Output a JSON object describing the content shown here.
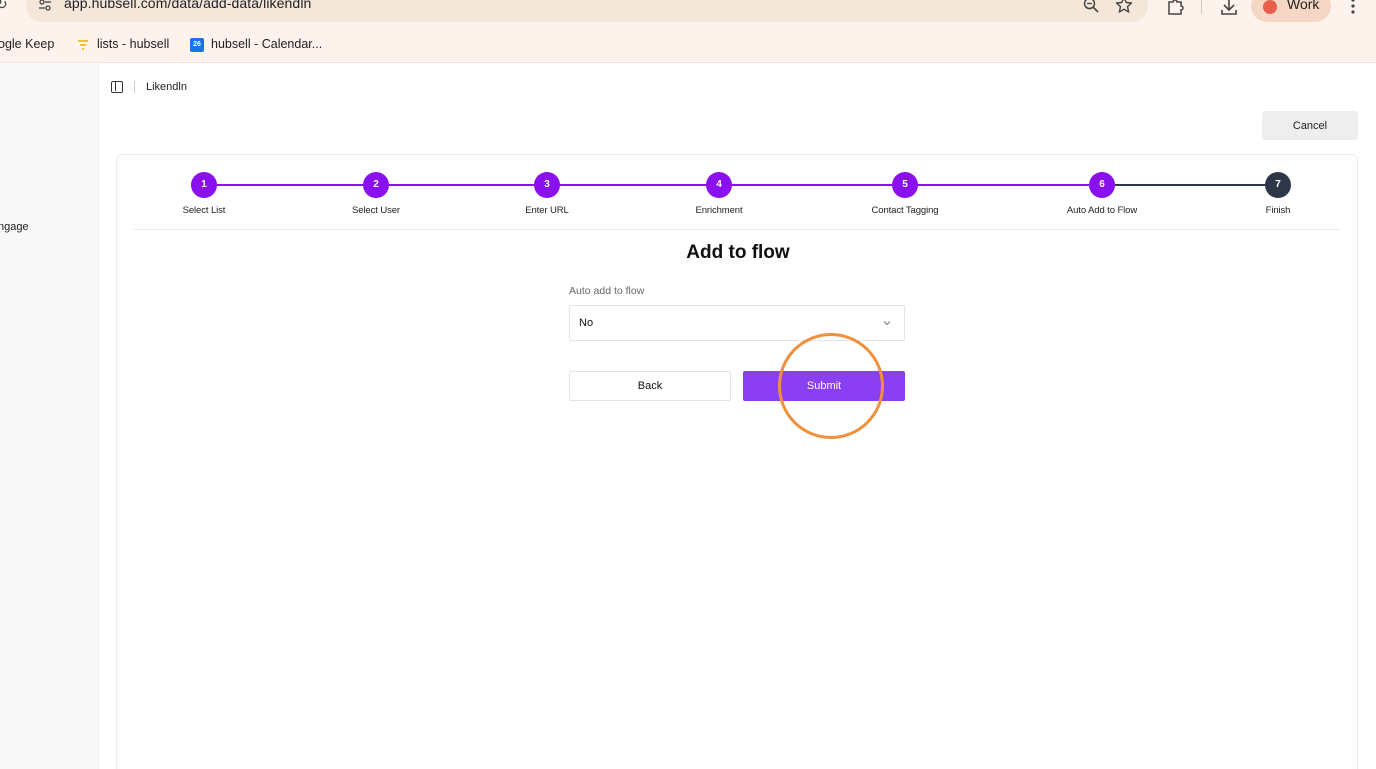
{
  "browser": {
    "url": "app.hubsell.com/data/add-data/likendln",
    "profile_label": "Work",
    "bookmarks": [
      {
        "label": "ogle Keep"
      },
      {
        "label": "lists - hubsell"
      },
      {
        "label": "hubsell - Calendar..."
      }
    ],
    "calendar_icon_text": "26"
  },
  "sidebar": {
    "partial_item": "ngage"
  },
  "header": {
    "breadcrumb": "Likendln",
    "cancel_label": "Cancel"
  },
  "stepper": {
    "active_color": "#8a10f0",
    "pending_color": "#2d3748",
    "steps": [
      {
        "number": "1",
        "label": "Select List",
        "status": "complete"
      },
      {
        "number": "2",
        "label": "Select User",
        "status": "complete"
      },
      {
        "number": "3",
        "label": "Enter URL",
        "status": "complete"
      },
      {
        "number": "4",
        "label": "Enrichment",
        "status": "complete"
      },
      {
        "number": "5",
        "label": "Contact Tagging",
        "status": "complete"
      },
      {
        "number": "6",
        "label": "Auto Add to Flow",
        "status": "current"
      },
      {
        "number": "7",
        "label": "Finish",
        "status": "pending"
      }
    ]
  },
  "form": {
    "title": "Add to flow",
    "field_label": "Auto add to flow",
    "select_value": "No",
    "back_label": "Back",
    "submit_label": "Submit",
    "submit_color": "#8b3ff2"
  },
  "annotation": {
    "highlight_color": "#f0903c"
  }
}
